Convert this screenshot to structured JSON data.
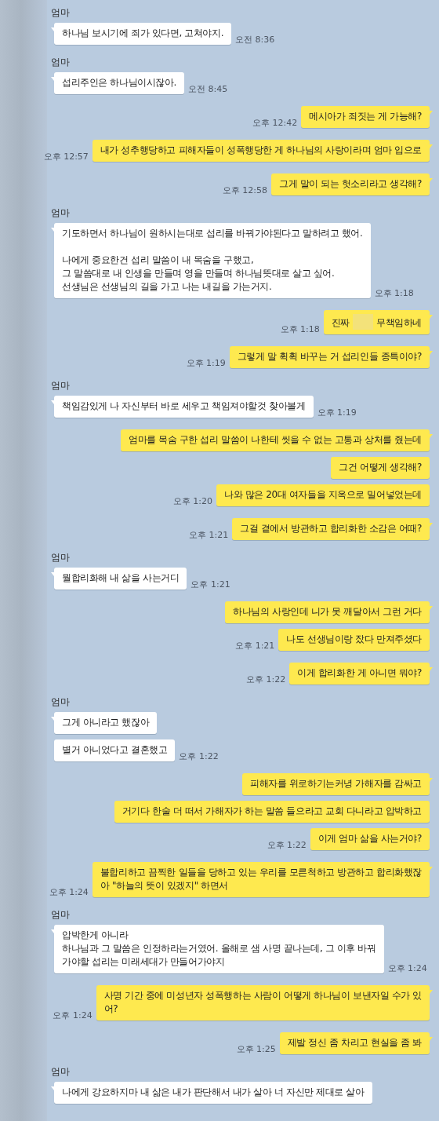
{
  "chat": {
    "groups": [
      {
        "kind": "them",
        "sender": "엄마",
        "messages": [
          {
            "paragraphs": [
              [
                "하나님 보시기에 죄가 있다면, 고쳐야지."
              ]
            ],
            "time": "오전 8:36"
          }
        ]
      },
      {
        "kind": "them",
        "sender": "엄마",
        "messages": [
          {
            "paragraphs": [
              [
                "섭리주인은 하나님이시잖아."
              ]
            ],
            "time": "오전 8:45"
          }
        ]
      },
      {
        "kind": "me",
        "messages": [
          {
            "paragraphs": [
              [
                "메시아가 죄짓는 게 가능해?"
              ]
            ],
            "time": "오후 12:42"
          }
        ]
      },
      {
        "kind": "me",
        "messages": [
          {
            "paragraphs": [
              [
                "내가 성추행당하고 피해자들이 성폭행당한 게 하나님의 사랑이라며 엄마 입으로"
              ]
            ],
            "time": "오후 12:57"
          }
        ]
      },
      {
        "kind": "me",
        "messages": [
          {
            "paragraphs": [
              [
                "그게 말이 되는 헛소리라고 생각해?"
              ]
            ],
            "time": "오후 12:58"
          }
        ]
      },
      {
        "kind": "them",
        "sender": "엄마",
        "messages": [
          {
            "paragraphs": [
              [
                "기도하면서 하나님이 원하시는대로 섭리를 바꿔가야된다고 말하려고 했어."
              ],
              [
                "나에게 중요한건 섭리 말씀이 내 목숨을 구했고,",
                "그 말씀대로 내 인생을 만들며 영을 만들며 하나님뜻대로 살고 싶어.",
                "선생님은 선생님의 길을 가고 나는 내길을 가는거지."
              ]
            ],
            "time": "오후 1:18"
          }
        ]
      },
      {
        "kind": "me",
        "messages": [
          {
            "parts": [
              "진짜",
              "무책임하네"
            ],
            "redacted": true,
            "time": "오후 1:18"
          }
        ]
      },
      {
        "kind": "me",
        "messages": [
          {
            "paragraphs": [
              [
                "그렇게 말 휙휙 바꾸는 거 섭리인들 종특이야?"
              ]
            ],
            "time": "오후 1:19"
          }
        ]
      },
      {
        "kind": "them",
        "sender": "엄마",
        "messages": [
          {
            "paragraphs": [
              [
                "책임감있게 나 자신부터 바로 세우고 책임져야할것 찾아볼게"
              ]
            ],
            "time": "오후 1:19"
          }
        ]
      },
      {
        "kind": "me",
        "messages": [
          {
            "paragraphs": [
              [
                "엄마를 목숨 구한 섭리 말씀이 나한테 씻을 수 없는 고통과 상처를 줬는데"
              ]
            ]
          },
          {
            "paragraphs": [
              [
                "그건 어떻게 생각해?"
              ]
            ]
          },
          {
            "paragraphs": [
              [
                "나와 많은 20대 여자들을 지옥으로 밀어넣었는데"
              ]
            ],
            "time": "오후 1:20"
          }
        ]
      },
      {
        "kind": "me",
        "messages": [
          {
            "paragraphs": [
              [
                "그걸 곁에서 방관하고 합리화한 소감은 어때?"
              ]
            ],
            "time": "오후 1:21"
          }
        ]
      },
      {
        "kind": "them",
        "sender": "엄마",
        "messages": [
          {
            "paragraphs": [
              [
                "뭘합리화해 내 삶을 사는거디"
              ]
            ],
            "time": "오후 1:21"
          }
        ]
      },
      {
        "kind": "me",
        "messages": [
          {
            "paragraphs": [
              [
                "하나님의 사랑인데 니가 못 깨달아서 그런 거다"
              ]
            ]
          },
          {
            "paragraphs": [
              [
                "나도 선생님이랑 잤다 만져주셨다"
              ]
            ],
            "time": "오후 1:21"
          }
        ]
      },
      {
        "kind": "me",
        "messages": [
          {
            "paragraphs": [
              [
                "이게 합리화한 게 아니면 뭐야?"
              ]
            ],
            "time": "오후 1:22"
          }
        ]
      },
      {
        "kind": "them",
        "sender": "엄마",
        "messages": [
          {
            "paragraphs": [
              [
                "그게 아니라고 했잖아"
              ]
            ]
          },
          {
            "paragraphs": [
              [
                "별거 아니었다고 결혼했고"
              ]
            ],
            "time": "오후 1:22"
          }
        ]
      },
      {
        "kind": "me",
        "messages": [
          {
            "paragraphs": [
              [
                "피해자를 위로하기는커녕 가해자를 감싸고"
              ]
            ]
          },
          {
            "paragraphs": [
              [
                "거기다 한술 더 떠서 가해자가 하는 말씀 들으라고 교회 다니라고 압박하고"
              ]
            ]
          },
          {
            "paragraphs": [
              [
                "이게 엄마 삶을 사는거야?"
              ]
            ],
            "time": "오후 1:22"
          }
        ]
      },
      {
        "kind": "me",
        "messages": [
          {
            "paragraphs": [
              [
                "불합리하고 끔찍한 일들을 당하고 있는 우리를 모른척하고 방관하고 합리화했잖",
                "아 \"하늘의 뜻이 있겠지\" 하면서"
              ]
            ],
            "time": "오후 1:24"
          }
        ]
      },
      {
        "kind": "them",
        "sender": "엄마",
        "messages": [
          {
            "paragraphs": [
              [
                "압박한게 아니라",
                "하나님과 그 말씀은 인정하라는거였어. 올해로 샘 사명 끝나는데, 그 이후 바꿔",
                "가야할 섭리는 미래세대가 만들어가야지"
              ]
            ],
            "time": "오후 1:24"
          }
        ]
      },
      {
        "kind": "me",
        "messages": [
          {
            "paragraphs": [
              [
                "사명 기간 중에 미성년자 성폭행하는 사람이 어떻게 하나님이 보낸자일 수가 있",
                "어?"
              ]
            ],
            "time": "오후 1:24"
          }
        ]
      },
      {
        "kind": "me",
        "messages": [
          {
            "paragraphs": [
              [
                "제발 정신 좀 차리고 현실을 좀 봐"
              ]
            ],
            "time": "오후 1:25"
          }
        ]
      },
      {
        "kind": "them",
        "sender": "엄마",
        "messages": [
          {
            "paragraphs": [
              [
                "나에게 강요하지마 내 삶은 내가 판단해서 내가 살아 너 자신만 제대로 살아"
              ]
            ]
          }
        ]
      }
    ]
  }
}
